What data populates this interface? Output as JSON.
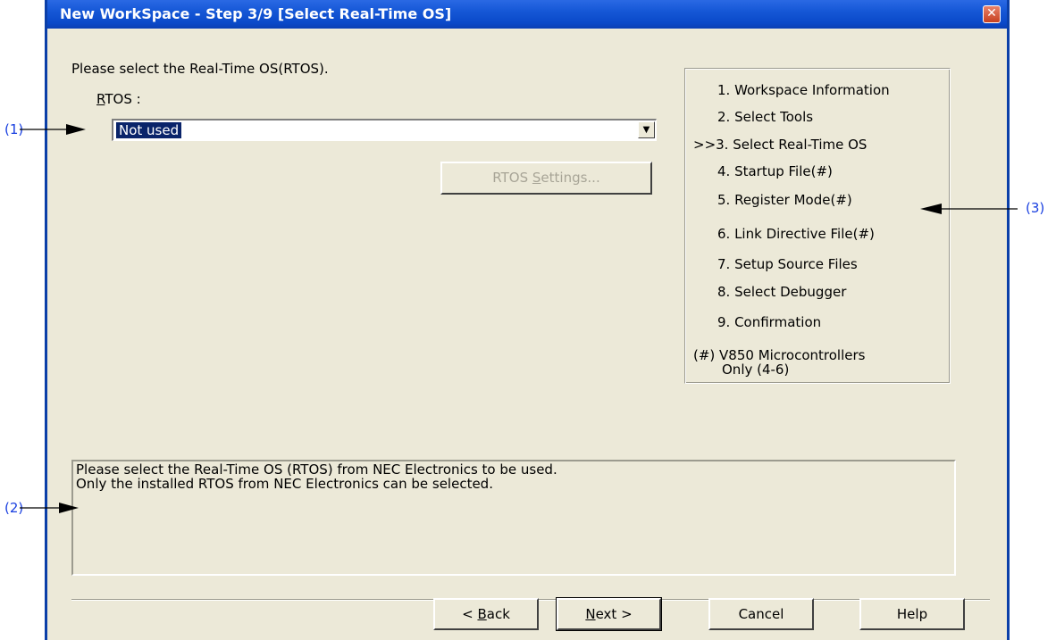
{
  "window": {
    "title": "New WorkSpace - Step 3/9 [Select Real-Time OS]",
    "close_glyph": "✕"
  },
  "prompt": "Please select the Real-Time OS(RTOS).",
  "rtos": {
    "label_mnemonic": "R",
    "label_rest": "TOS :",
    "selected_value": "Not used",
    "settings_button": {
      "pre": "RTOS ",
      "mnemonic": "S",
      "post": "ettings...",
      "enabled": false
    }
  },
  "steps": {
    "items": [
      "1. Workspace Information",
      "2. Select Tools",
      ">>3. Select Real-Time OS",
      "4. Startup File(#)",
      "5. Register Mode(#)",
      "6. Link Directive File(#)",
      "7. Setup Source Files",
      "8. Select Debugger",
      "9. Confirmation"
    ],
    "footnote_line1": "(#) V850 Microcontrollers",
    "footnote_line2": "Only (4-6)"
  },
  "description": {
    "line1": "Please select the Real-Time OS (RTOS) from NEC Electronics to be used.",
    "line2": "Only the installed RTOS from NEC Electronics can be selected."
  },
  "buttons": {
    "back": {
      "pre": "< ",
      "mnemonic": "B",
      "post": "ack"
    },
    "next": {
      "mnemonic": "N",
      "post": "ext >"
    },
    "cancel": "Cancel",
    "help": "Help"
  },
  "callouts": {
    "one": "(1)",
    "two": "(2)",
    "three": "(3)",
    "color": "#1a40e0"
  }
}
